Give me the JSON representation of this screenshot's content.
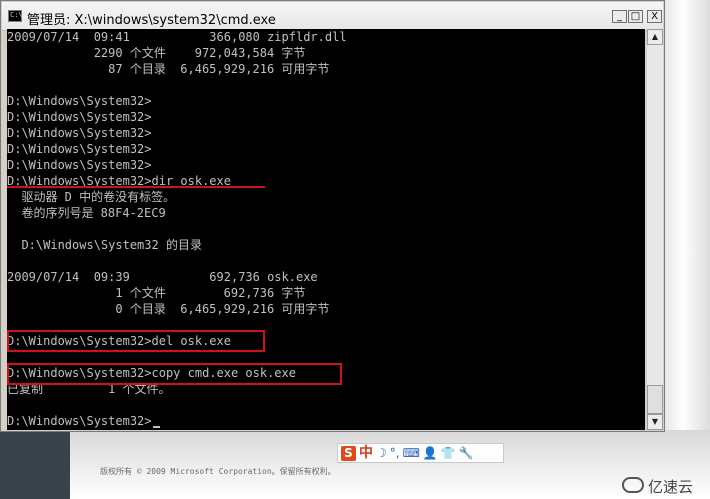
{
  "window": {
    "title": "管理员: X:\\windows\\system32\\cmd.exe",
    "icon_label": "C:\\",
    "minimize_glyph": "_",
    "maximize_glyph": "□",
    "close_glyph": "X"
  },
  "console": {
    "lines": [
      "2009/07/14  09:41           366,080 zipfldr.dll",
      "            2290 个文件    972,043,584 字节",
      "              87 个目录  6,465,929,216 可用字节",
      "",
      "D:\\Windows\\System32>",
      "D:\\Windows\\System32>",
      "D:\\Windows\\System32>",
      "D:\\Windows\\System32>",
      "D:\\Windows\\System32>",
      "D:\\Windows\\System32>dir osk.exe",
      "  驱动器 D 中的卷没有标签。",
      "  卷的序列号是 88F4-2EC9",
      "",
      "  D:\\Windows\\System32 的目录",
      "",
      "2009/07/14  09:39           692,736 osk.exe",
      "               1 个文件        692,736 字节",
      "               0 个目录  6,465,929,216 可用字节",
      "",
      "D:\\Windows\\System32>del osk.exe",
      "",
      "D:\\Windows\\System32>copy cmd.exe osk.exe",
      "已复制         1 个文件。",
      "",
      "D:\\Windows\\System32>"
    ]
  },
  "ime_toolbar": {
    "logo": "S",
    "mode": "中",
    "items": [
      "☽",
      "°,",
      "⌨",
      "👤",
      "👕",
      "🔧"
    ]
  },
  "background": {
    "copyright": "版权所有 © 2009 Microsoft Corporation。保留所有权利。",
    "brand": "亿速云"
  },
  "colors": {
    "console_bg": "#000000",
    "console_text": "#c0c0c0",
    "highlight": "#d0101a"
  }
}
